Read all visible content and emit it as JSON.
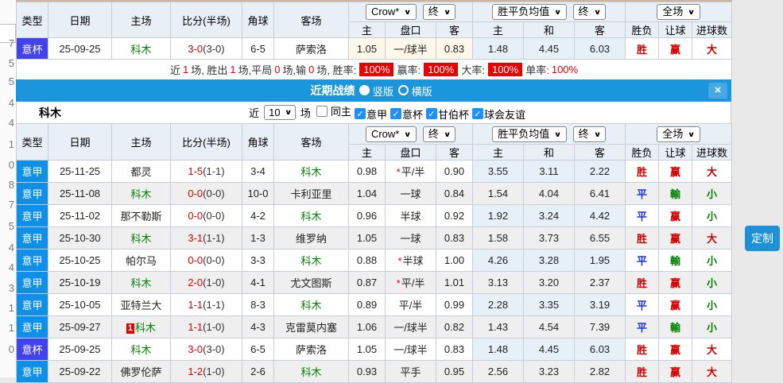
{
  "page": {
    "customize_button": "定制",
    "left_strip_digits": [
      "7",
      "5",
      "5",
      "4",
      "4",
      "1",
      "0",
      "8",
      "7",
      "5",
      "4",
      "4",
      "3",
      "1",
      "1",
      "0"
    ]
  },
  "columns": {
    "merged": [
      "类型",
      "日期",
      "主场",
      "比分(半场)",
      "角球",
      "客场"
    ],
    "sub": [
      "主",
      "盘口",
      "客",
      "主",
      "和",
      "客",
      "胜负",
      "让球",
      "进球数"
    ],
    "dropdown_groups": [
      [
        "Crow*",
        "终"
      ],
      [
        "胜平负均值",
        "终"
      ],
      [
        "全场"
      ]
    ]
  },
  "top_match": {
    "league": "意杯",
    "league_class": "bei",
    "date": "25-09-25",
    "home": "科木",
    "home_green": true,
    "home_mark": "",
    "score": "3-0",
    "half": "(3-0)",
    "corner": "6-5",
    "away": "萨索洛",
    "away_green": false,
    "odds_home": "1.05",
    "handicap": "一/球半",
    "handicap_star": false,
    "odds_away": "0.83",
    "avg_home": "1.48",
    "avg_draw": "4.45",
    "avg_away": "6.03",
    "result": "胜",
    "result_cls": "red",
    "spread": "赢",
    "spread_cls": "red",
    "goals": "大",
    "goals_cls": "red"
  },
  "stats_parts": [
    {
      "text": "近 ",
      "type": "plain"
    },
    {
      "text": "1",
      "type": "num"
    },
    {
      "text": " 场, 胜出 ",
      "type": "plain"
    },
    {
      "text": "1",
      "type": "num"
    },
    {
      "text": " 场,平局 ",
      "type": "plain"
    },
    {
      "text": "0",
      "type": "num"
    },
    {
      "text": " 场,输 ",
      "type": "plain"
    },
    {
      "text": "0",
      "type": "num"
    },
    {
      "text": " 场, 胜率: ",
      "type": "plain"
    },
    {
      "text": "100%",
      "type": "badge"
    },
    {
      "text": " 赢率: ",
      "type": "plain"
    },
    {
      "text": "100%",
      "type": "badge"
    },
    {
      "text": "大率: ",
      "type": "plain"
    },
    {
      "text": "100%",
      "type": "badge"
    },
    {
      "text": " 单率: ",
      "type": "plain"
    },
    {
      "text": "100%",
      "type": "rednum"
    }
  ],
  "popup": {
    "title": "近期战绩",
    "layout_options": [
      {
        "label": "竖版",
        "selected": true
      },
      {
        "label": "横版",
        "selected": false
      }
    ],
    "close_label": "×",
    "team": "科木",
    "near_label": "近",
    "count_value": "10",
    "unit_label": "场",
    "filters": [
      {
        "label": "同主",
        "checked": false
      },
      {
        "label": "意甲",
        "checked": true
      },
      {
        "label": "意杯",
        "checked": true
      },
      {
        "label": "甘伯杯",
        "checked": true
      },
      {
        "label": "球会友谊",
        "checked": true
      }
    ],
    "matches": [
      {
        "league": "意甲",
        "league_class": "jia",
        "date": "25-11-25",
        "home": "都灵",
        "home_green": false,
        "home_mark": "",
        "score": "1-5",
        "half": "(1-1)",
        "corner": "3-4",
        "away": "科木",
        "away_green": true,
        "odds_home": "0.98",
        "handicap": "平/半",
        "handicap_star": true,
        "odds_away": "0.90",
        "avg_home": "3.55",
        "avg_draw": "3.11",
        "avg_away": "2.22",
        "result": "胜",
        "result_cls": "red",
        "spread": "赢",
        "spread_cls": "red",
        "goals": "大",
        "goals_cls": "red"
      },
      {
        "league": "意甲",
        "league_class": "jia",
        "date": "25-11-08",
        "home": "科木",
        "home_green": true,
        "home_mark": "",
        "score": "0-0",
        "half": "(0-0)",
        "corner": "10-0",
        "away": "卡利亚里",
        "away_green": false,
        "odds_home": "1.04",
        "handicap": "一球",
        "handicap_star": false,
        "odds_away": "0.84",
        "avg_home": "1.54",
        "avg_draw": "4.04",
        "avg_away": "6.41",
        "result": "平",
        "result_cls": "blue",
        "spread": "輸",
        "spread_cls": "green",
        "goals": "小",
        "goals_cls": "green"
      },
      {
        "league": "意甲",
        "league_class": "jia",
        "date": "25-11-02",
        "home": "那不勒斯",
        "home_green": false,
        "home_mark": "",
        "score": "0-0",
        "half": "(0-0)",
        "corner": "4-2",
        "away": "科木",
        "away_green": true,
        "odds_home": "0.96",
        "handicap": "半球",
        "handicap_star": false,
        "odds_away": "0.92",
        "avg_home": "1.92",
        "avg_draw": "3.24",
        "avg_away": "4.42",
        "result": "平",
        "result_cls": "blue",
        "spread": "赢",
        "spread_cls": "red",
        "goals": "小",
        "goals_cls": "green"
      },
      {
        "league": "意甲",
        "league_class": "jia",
        "date": "25-10-30",
        "home": "科木",
        "home_green": true,
        "home_mark": "",
        "score": "3-1",
        "half": "(1-1)",
        "corner": "1-3",
        "away": "维罗纳",
        "away_green": false,
        "odds_home": "1.05",
        "handicap": "一球",
        "handicap_star": false,
        "odds_away": "0.83",
        "avg_home": "1.58",
        "avg_draw": "3.73",
        "avg_away": "6.55",
        "result": "胜",
        "result_cls": "red",
        "spread": "赢",
        "spread_cls": "red",
        "goals": "大",
        "goals_cls": "red"
      },
      {
        "league": "意甲",
        "league_class": "jia",
        "date": "25-10-25",
        "home": "帕尔马",
        "home_green": false,
        "home_mark": "",
        "score": "0-0",
        "half": "(0-0)",
        "corner": "3-3",
        "away": "科木",
        "away_green": true,
        "odds_home": "0.88",
        "handicap": "半球",
        "handicap_star": true,
        "odds_away": "1.00",
        "avg_home": "4.26",
        "avg_draw": "3.28",
        "avg_away": "1.95",
        "result": "平",
        "result_cls": "blue",
        "spread": "輸",
        "spread_cls": "green",
        "goals": "小",
        "goals_cls": "green"
      },
      {
        "league": "意甲",
        "league_class": "jia",
        "date": "25-10-19",
        "home": "科木",
        "home_green": true,
        "home_mark": "",
        "score": "2-0",
        "half": "(1-0)",
        "corner": "4-1",
        "away": "尤文图斯",
        "away_green": false,
        "odds_home": "0.87",
        "handicap": "平/半",
        "handicap_star": true,
        "odds_away": "1.01",
        "avg_home": "3.13",
        "avg_draw": "3.20",
        "avg_away": "2.37",
        "result": "胜",
        "result_cls": "red",
        "spread": "赢",
        "spread_cls": "red",
        "goals": "小",
        "goals_cls": "green"
      },
      {
        "league": "意甲",
        "league_class": "jia",
        "date": "25-10-05",
        "home": "亚特兰大",
        "home_green": false,
        "home_mark": "",
        "score": "1-1",
        "half": "(1-1)",
        "corner": "8-3",
        "away": "科木",
        "away_green": true,
        "odds_home": "0.89",
        "handicap": "平/半",
        "handicap_star": false,
        "odds_away": "0.99",
        "avg_home": "2.28",
        "avg_draw": "3.35",
        "avg_away": "3.19",
        "result": "平",
        "result_cls": "blue",
        "spread": "赢",
        "spread_cls": "red",
        "goals": "小",
        "goals_cls": "green"
      },
      {
        "league": "意甲",
        "league_class": "jia",
        "date": "25-09-27",
        "home": "科木",
        "home_green": true,
        "home_mark": "1",
        "score": "1-1",
        "half": "(1-0)",
        "corner": "4-3",
        "away": "克雷莫内塞",
        "away_green": false,
        "odds_home": "1.06",
        "handicap": "一/球半",
        "handicap_star": false,
        "odds_away": "0.82",
        "avg_home": "1.43",
        "avg_draw": "4.54",
        "avg_away": "7.39",
        "result": "平",
        "result_cls": "blue",
        "spread": "輸",
        "spread_cls": "green",
        "goals": "小",
        "goals_cls": "green"
      },
      {
        "league": "意杯",
        "league_class": "bei",
        "date": "25-09-25",
        "home": "科木",
        "home_green": true,
        "home_mark": "",
        "score": "3-0",
        "half": "(3-0)",
        "corner": "6-5",
        "away": "萨索洛",
        "away_green": false,
        "odds_home": "1.05",
        "handicap": "一/球半",
        "handicap_star": false,
        "odds_away": "0.83",
        "avg_home": "1.48",
        "avg_draw": "4.45",
        "avg_away": "6.03",
        "result": "胜",
        "result_cls": "red",
        "spread": "赢",
        "spread_cls": "red",
        "goals": "大",
        "goals_cls": "red"
      },
      {
        "league": "意甲",
        "league_class": "jia",
        "date": "25-09-22",
        "home": "佛罗伦萨",
        "home_green": false,
        "home_mark": "",
        "score": "1-2",
        "half": "(1-0)",
        "corner": "2-6",
        "away": "科木",
        "away_green": true,
        "odds_home": "0.93",
        "handicap": "平手",
        "handicap_star": false,
        "odds_away": "0.95",
        "avg_home": "2.56",
        "avg_draw": "3.23",
        "avg_away": "2.82",
        "result": "胜",
        "result_cls": "red",
        "spread": "赢",
        "spread_cls": "red",
        "goals": "大",
        "goals_cls": "red"
      }
    ]
  }
}
